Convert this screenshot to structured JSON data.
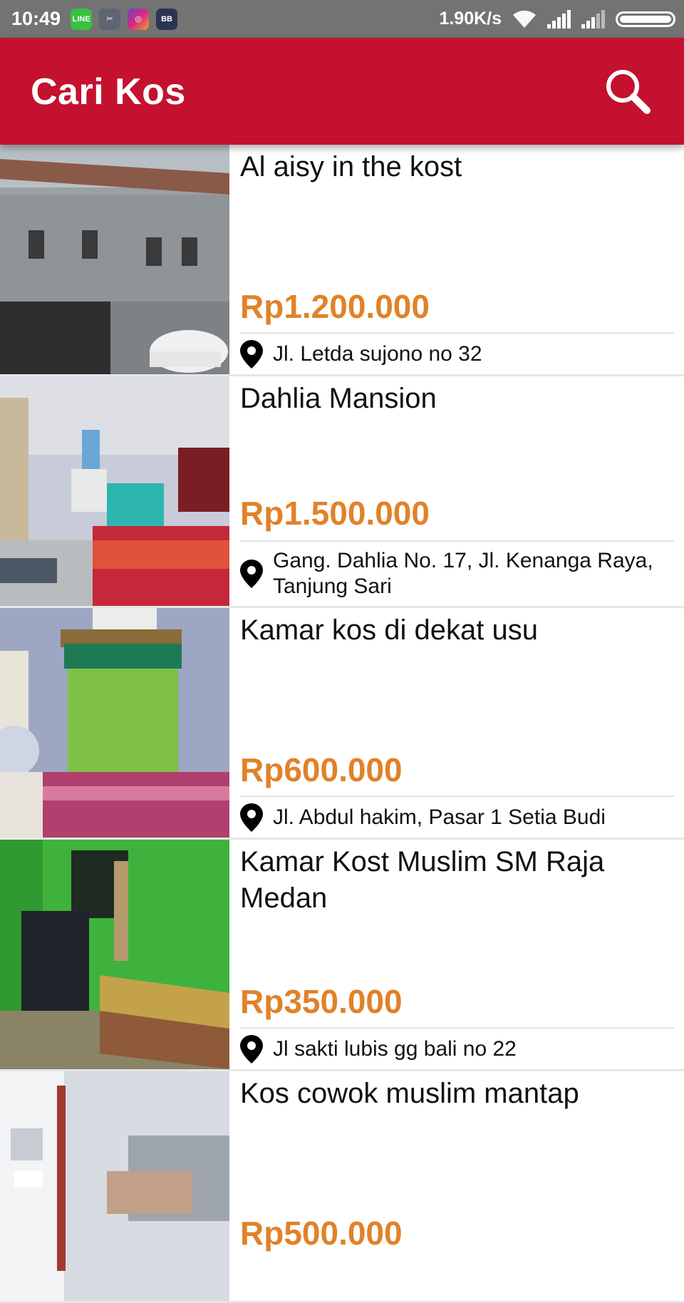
{
  "status_bar": {
    "time": "10:49",
    "apps": [
      "LINE",
      "✂",
      "◎",
      "BB"
    ],
    "speed": "1.90K/s",
    "icons": [
      "line-app-icon",
      "scissors-app-icon",
      "instagram-app-icon",
      "bbm-app-icon",
      "wifi-icon",
      "signal-icon",
      "battery-icon"
    ]
  },
  "app_bar": {
    "title": "Cari Kos",
    "search_icon": "search-icon"
  },
  "colors": {
    "app_bar": "#c4112f",
    "price": "#e08228",
    "status_bar": "#737373"
  },
  "listings": [
    {
      "name": "Al aisy in the kost",
      "price": "Rp1.200.000",
      "address": "Jl. Letda sujono no 32"
    },
    {
      "name": "Dahlia Mansion",
      "price": "Rp1.500.000",
      "address": "Gang. Dahlia No. 17, Jl. Kenanga Raya, Tanjung Sari"
    },
    {
      "name": "Kamar kos di dekat usu",
      "price": "Rp600.000",
      "address": "Jl. Abdul hakim, Pasar 1 Setia Budi"
    },
    {
      "name": "Kamar Kost Muslim SM Raja Medan",
      "price": "Rp350.000",
      "address": "Jl sakti lubis gg bali no 22"
    },
    {
      "name": "Kos cowok muslim mantap",
      "price": "Rp500.000",
      "address": ""
    }
  ]
}
